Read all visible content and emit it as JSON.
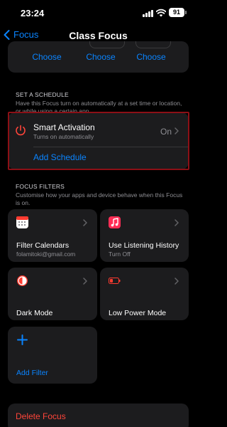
{
  "status_bar": {
    "time": "23:24",
    "battery": "91"
  },
  "nav": {
    "back_label": "Focus",
    "title": "Class Focus"
  },
  "top_card": {
    "choose_labels": [
      "Choose",
      "Choose",
      "Choose"
    ]
  },
  "schedule": {
    "header": "SET A SCHEDULE",
    "description": "Have this Focus turn on automatically at a set time or location, or while using a certain app.",
    "smart_activation": {
      "title": "Smart Activation",
      "subtitle": "Turns on automatically",
      "value": "On"
    },
    "add_schedule": "Add Schedule"
  },
  "filters": {
    "header": "FOCUS FILTERS",
    "description": "Customise how your apps and device behave when this Focus is on.",
    "tiles": [
      {
        "title": "Filter Calendars",
        "subtitle": "folamitoki@gmail.com",
        "icon": "calendar-icon"
      },
      {
        "title": "Use Listening History",
        "subtitle": "Turn Off",
        "icon": "music-icon"
      },
      {
        "title": "Dark Mode",
        "subtitle": "",
        "icon": "dark-mode-icon"
      },
      {
        "title": "Low Power Mode",
        "subtitle": "",
        "icon": "battery-icon"
      },
      {
        "title": "Add Filter",
        "subtitle": "",
        "icon": "plus-icon"
      }
    ]
  },
  "delete_label": "Delete Focus",
  "colors": {
    "accent": "#0a84ff",
    "destructive": "#ff453a",
    "highlight": "#8c1016",
    "card": "#1c1c1e"
  }
}
